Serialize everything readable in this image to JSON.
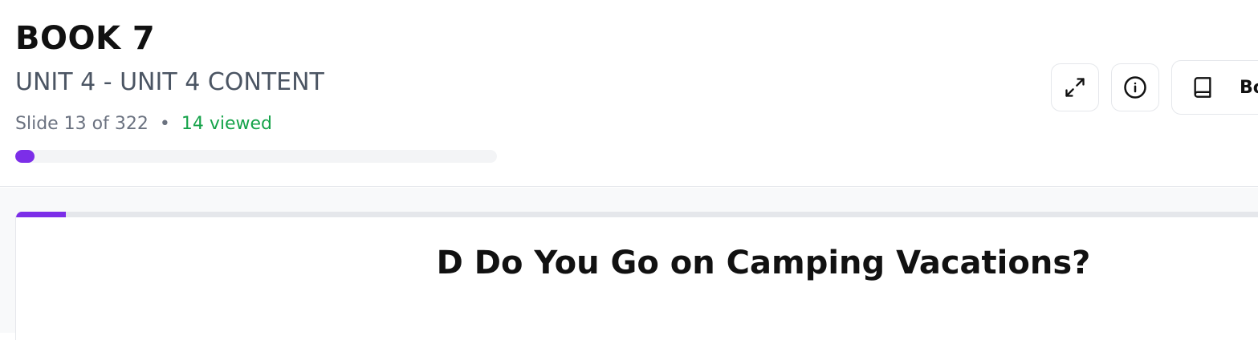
{
  "header": {
    "book_title": "BOOK 7",
    "unit_title": "UNIT 4 - UNIT 4 CONTENT",
    "slide_position": "Slide 13 of 322",
    "separator": "•",
    "viewed_count": "14 viewed",
    "progress_percent": 4.0,
    "progress_color": "#7c2ee8"
  },
  "toolbar": {
    "expand_icon": "expand-icon",
    "info_icon": "info-icon",
    "book_icon": "book-icon",
    "book_label": "Bo"
  },
  "slide": {
    "heading": "D Do You Go on Camping Vacations?",
    "top_progress_percent": 4.0
  },
  "colors": {
    "accent": "#7c2ee8",
    "viewed_green": "#16a34a",
    "muted_text": "#6b7280"
  }
}
